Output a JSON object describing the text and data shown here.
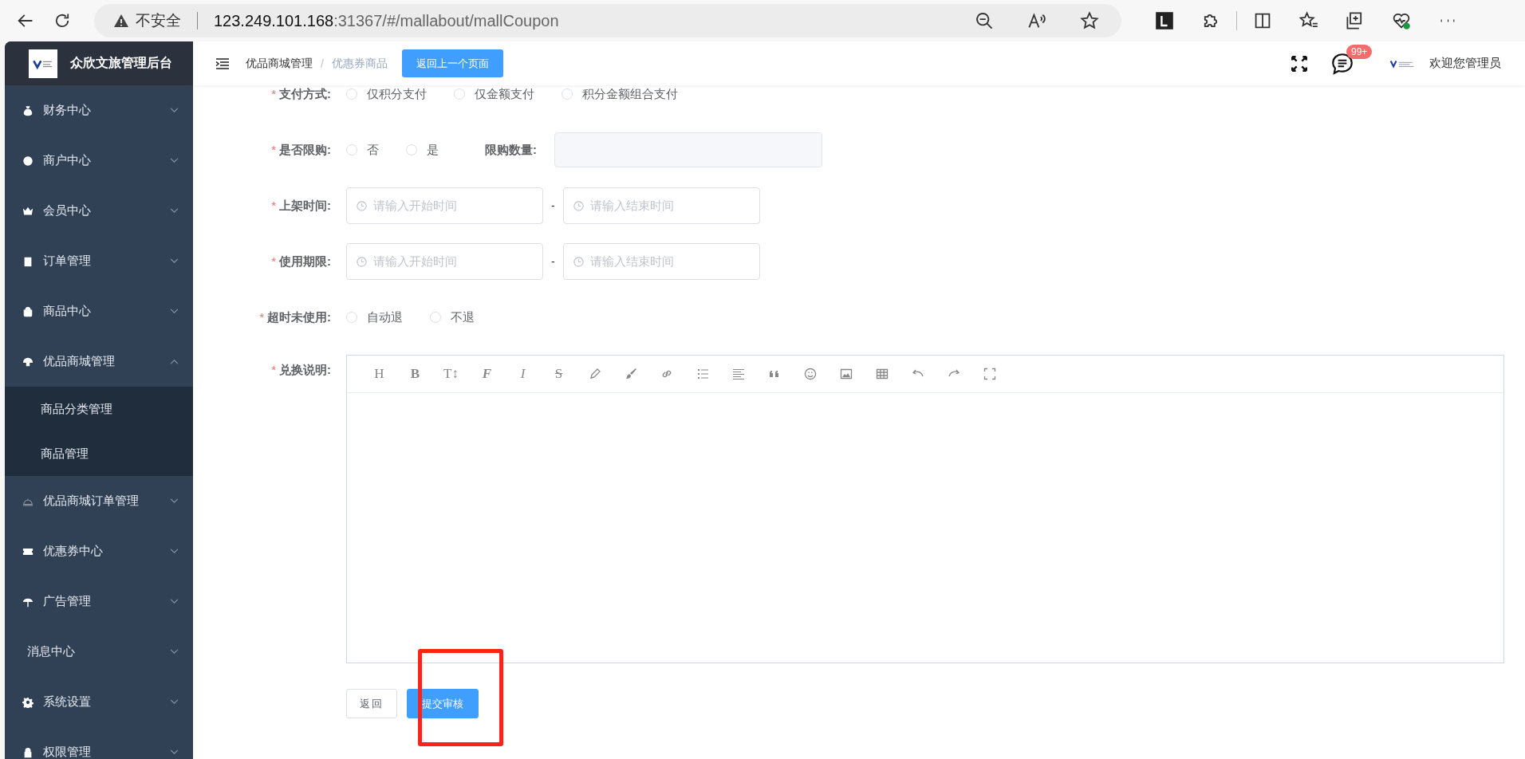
{
  "browser": {
    "security_label": "不安全",
    "url_host": "123.249.101.168",
    "url_rest": ":31367/#/mallabout/mallCoupon"
  },
  "sidebar": {
    "title": "众欣文旅管理后台",
    "items": [
      {
        "label": "财务中心",
        "expanded": false
      },
      {
        "label": "商户中心",
        "expanded": false
      },
      {
        "label": "会员中心",
        "expanded": false
      },
      {
        "label": "订单管理",
        "expanded": false
      },
      {
        "label": "商品中心",
        "expanded": false
      },
      {
        "label": "优品商城管理",
        "expanded": true,
        "children": [
          {
            "label": "商品分类管理"
          },
          {
            "label": "商品管理"
          }
        ]
      },
      {
        "label": "优品商城订单管理",
        "expanded": false
      },
      {
        "label": "优惠券中心",
        "expanded": false
      },
      {
        "label": "广告管理",
        "expanded": false
      },
      {
        "label": "消息中心",
        "expanded": false
      },
      {
        "label": "系统设置",
        "expanded": false
      },
      {
        "label": "权限管理",
        "expanded": false
      }
    ]
  },
  "header": {
    "breadcrumb": [
      "优品商城管理",
      "优惠券商品"
    ],
    "breadcrumb_separator": "/",
    "back_button": "返回上一个页面",
    "badge": "99+",
    "welcome": "欢迎您管理员"
  },
  "form": {
    "rows": [
      {
        "kind": "radio",
        "required_mark": "*",
        "label": "支付方式:",
        "options": [
          {
            "label": "仅积分支付",
            "selected": false
          },
          {
            "label": "仅金额支付",
            "selected": false
          },
          {
            "label": "积分金额组合支付",
            "selected": false
          }
        ]
      },
      {
        "kind": "radio",
        "required_mark": "*",
        "label": "是否限购:",
        "options": [
          {
            "label": "否",
            "selected": false
          },
          {
            "label": "是",
            "selected": false
          }
        ],
        "extra_field": {
          "label": "限购数量:"
        }
      },
      {
        "kind": "daterange",
        "required_mark": "*",
        "label": "上架时间:",
        "start_placeholder": "请输入开始时间",
        "separator": "-",
        "end_placeholder": "请输入结束时间"
      },
      {
        "kind": "daterange",
        "required_mark": "*",
        "label": "使用期限:",
        "start_placeholder": "请输入开始时间",
        "separator": "-",
        "end_placeholder": "请输入结束时间"
      },
      {
        "kind": "radio",
        "required_mark": "*",
        "label": "超时未使用:",
        "options": [
          {
            "label": "自动退",
            "selected": false
          },
          {
            "label": "不退",
            "selected": false
          }
        ]
      },
      {
        "kind": "editor",
        "required_mark": "*",
        "label": "兑换说明:",
        "toolbar": [
          {
            "kind": "glyph",
            "text": "H"
          },
          {
            "kind": "glyph",
            "text": "B"
          },
          {
            "kind": "glyph",
            "text": "T↕"
          },
          {
            "kind": "glyph",
            "text": "F"
          },
          {
            "kind": "glyph",
            "text": "I"
          },
          {
            "kind": "glyph",
            "text": "S"
          },
          {
            "kind": "icon"
          },
          {
            "kind": "icon"
          },
          {
            "kind": "icon"
          },
          {
            "kind": "icon"
          },
          {
            "kind": "icon"
          },
          {
            "kind": "icon"
          },
          {
            "kind": "icon"
          },
          {
            "kind": "icon"
          },
          {
            "kind": "icon"
          },
          {
            "kind": "icon"
          },
          {
            "kind": "icon"
          },
          {
            "kind": "icon"
          }
        ]
      }
    ],
    "buttons": [
      {
        "label": "返回",
        "kind": "default"
      },
      {
        "label": "提交审核",
        "kind": "primary"
      }
    ]
  }
}
